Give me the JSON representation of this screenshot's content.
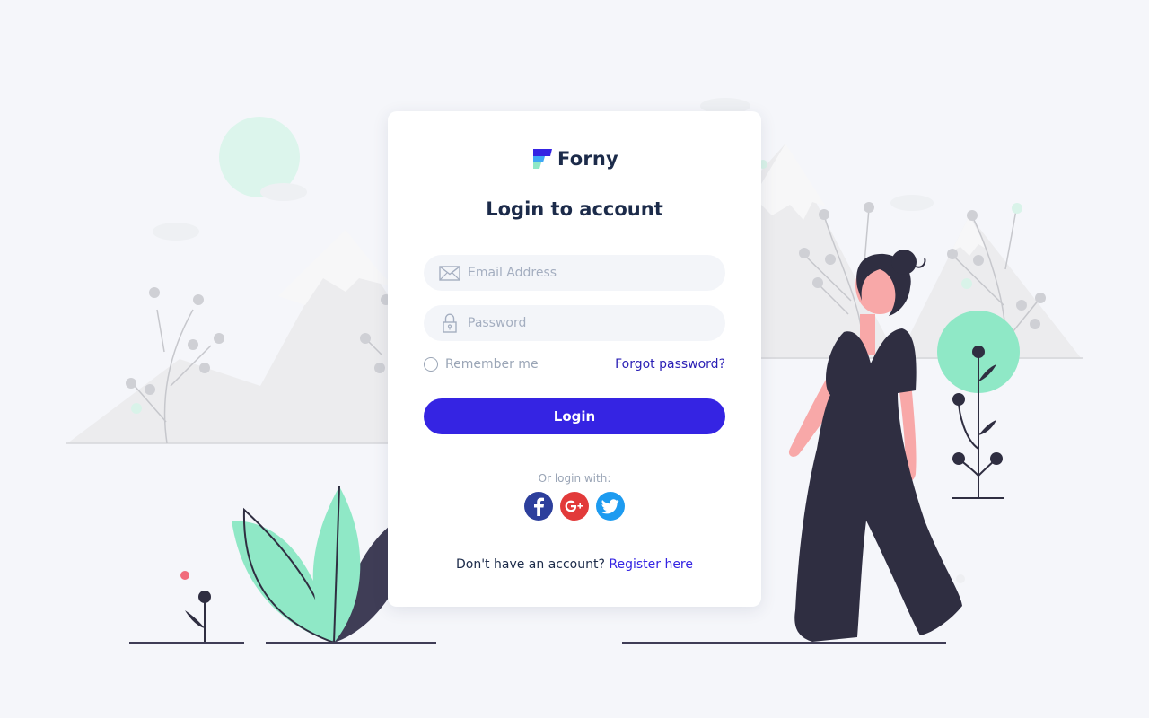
{
  "brand": {
    "name": "Forny",
    "logo_icon": "forny-logo"
  },
  "login": {
    "title": "Login to account",
    "email": {
      "placeholder": "Email Address",
      "value": "",
      "icon": "envelope-icon"
    },
    "password": {
      "placeholder": "Password",
      "value": "",
      "icon": "lock-icon"
    },
    "remember_label": "Remember me",
    "remember_checked": false,
    "forgot_label": "Forgot password?",
    "submit_label": "Login",
    "or_login_with": "Or login with:",
    "socials": [
      {
        "name": "Facebook",
        "icon": "facebook-icon",
        "color": "#2d3f9c"
      },
      {
        "name": "Google Plus",
        "icon": "google-plus-icon",
        "color": "#e23a3a"
      },
      {
        "name": "Twitter",
        "icon": "twitter-icon",
        "color": "#1d9bf0"
      }
    ],
    "register_prompt": "Don't have an account?",
    "register_link": "Register here"
  },
  "colors": {
    "primary": "#3524e3",
    "link": "#2a1fb5",
    "heading": "#1c2b4a",
    "muted": "#9aa5b6",
    "input_bg": "#f3f5f9",
    "page_bg": "#f5f6fa",
    "accent_green": "#8fe8c6",
    "dark_figure": "#2f2e41",
    "skin": "#f8a8a8"
  }
}
